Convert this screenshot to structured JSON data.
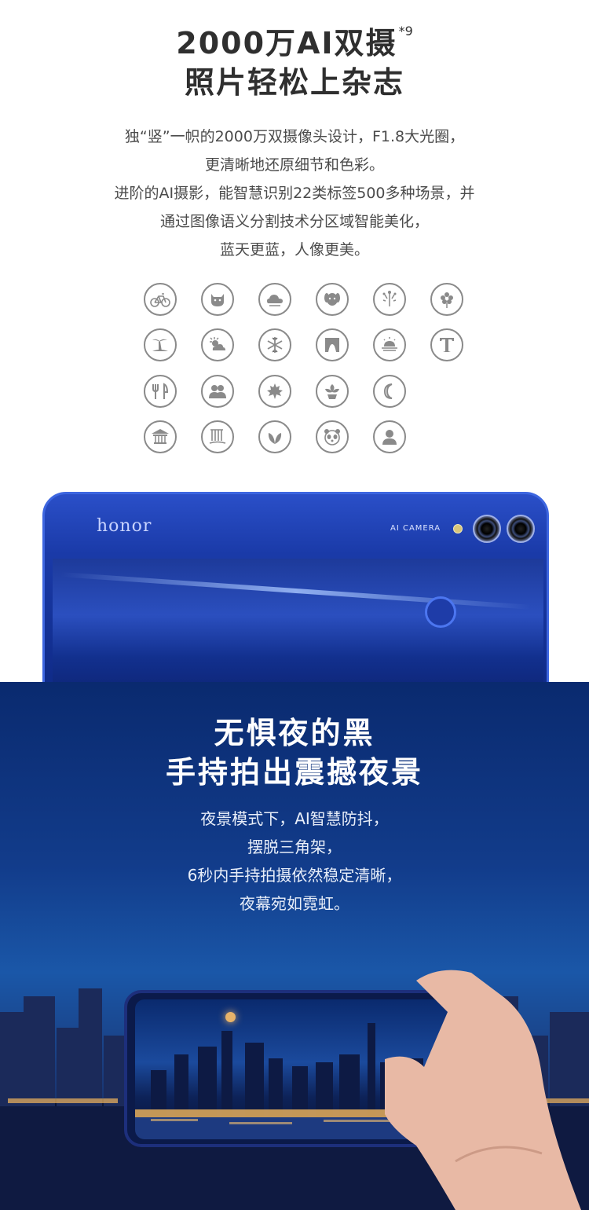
{
  "section1": {
    "title_line1": "2000万AI双摄",
    "title_sup": "*9",
    "title_line2": "照片轻松上杂志",
    "desc_lines": [
      "独“竖”一帜的2000万双摄像头设计，F1.8大光圈，",
      "更清晰地还原细节和色彩。",
      "进阶的AI摄影，能智慧识别22类标签500多种场景，并",
      "通过图像语义分割技术分区域智能美化，",
      "蓝天更蓝，人像更美。"
    ],
    "scene_icons": [
      [
        "bicycle-icon",
        "cat-icon",
        "cloud-icon",
        "dog-icon",
        "fireworks-icon",
        "flower-icon"
      ],
      [
        "beach-icon",
        "sunny-icon",
        "snowflake-icon",
        "stage-icon",
        "sunrise-icon",
        "text-icon"
      ],
      [
        "food-icon",
        "group-icon",
        "maple-leaf-icon",
        "plant-icon",
        "night-moon-icon"
      ],
      [
        "ancient-building-icon",
        "waterfall-icon",
        "greenery-icon",
        "panda-icon",
        "portrait-icon"
      ]
    ],
    "phone": {
      "brand": "honor",
      "camera_label": "AI CAMERA"
    },
    "colors": {
      "title": "#2f2f2f",
      "icon_stroke": "#8a8a8a",
      "phone_blue": "#1a3aa8"
    }
  },
  "section2": {
    "title_line1": "无惧夜的黑",
    "title_line2": "手持拍出震撼夜景",
    "desc_lines": [
      "夜景模式下，AI智慧防抖，",
      "摆脱三角架，",
      "6秒内手持拍摄依然稳定清晰，",
      "夜幕宛如霓虹。"
    ],
    "colors": {
      "background": "#123c8b",
      "title": "#ffffff"
    }
  }
}
